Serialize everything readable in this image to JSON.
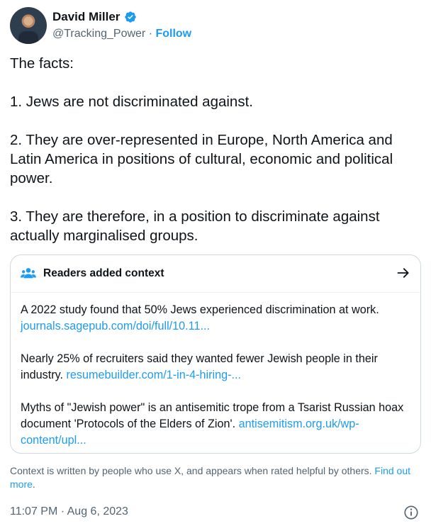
{
  "author": {
    "name": "David Miller",
    "handle": "@Tracking_Power",
    "separator": " · ",
    "follow_label": "Follow"
  },
  "tweet": {
    "paragraphs": [
      "The facts:",
      "1. Jews are not discriminated against.",
      "2. They are over-represented in Europe, North America and Latin America in positions of cultural, economic and political power.",
      "3. They are therefore, in a position to discriminate against actually marginalised groups."
    ]
  },
  "context": {
    "title": "Readers added context",
    "items": [
      {
        "text": "A 2022 study found that 50% Jews experienced discrimination at work. ",
        "link": "journals.sagepub.com/doi/full/10.11..."
      },
      {
        "text": "Nearly 25% of recruiters said they wanted fewer Jewish people in their industry. ",
        "link": "resumebuilder.com/1-in-4-hiring-..."
      },
      {
        "text": "Myths of \"Jewish power\" is an antisemitic trope from a Tsarist Russian hoax document 'Protocols of the Elders of Zion'. ",
        "link": "antisemitism.org.uk/wp-content/upl..."
      }
    ],
    "footnote": "Context is written by people who use X, and appears when rated helpful by others. ",
    "footnote_link": "Find out more",
    "footnote_end": "."
  },
  "meta": {
    "timestamp": "11:07 PM · Aug 6, 2023"
  },
  "colors": {
    "accent": "#1d9bf0",
    "muted": "#536471",
    "text": "#0f1419"
  },
  "icons": {
    "verified": "verified-badge-icon",
    "people": "people-icon",
    "arrow": "arrow-right-icon",
    "info": "info-icon"
  }
}
